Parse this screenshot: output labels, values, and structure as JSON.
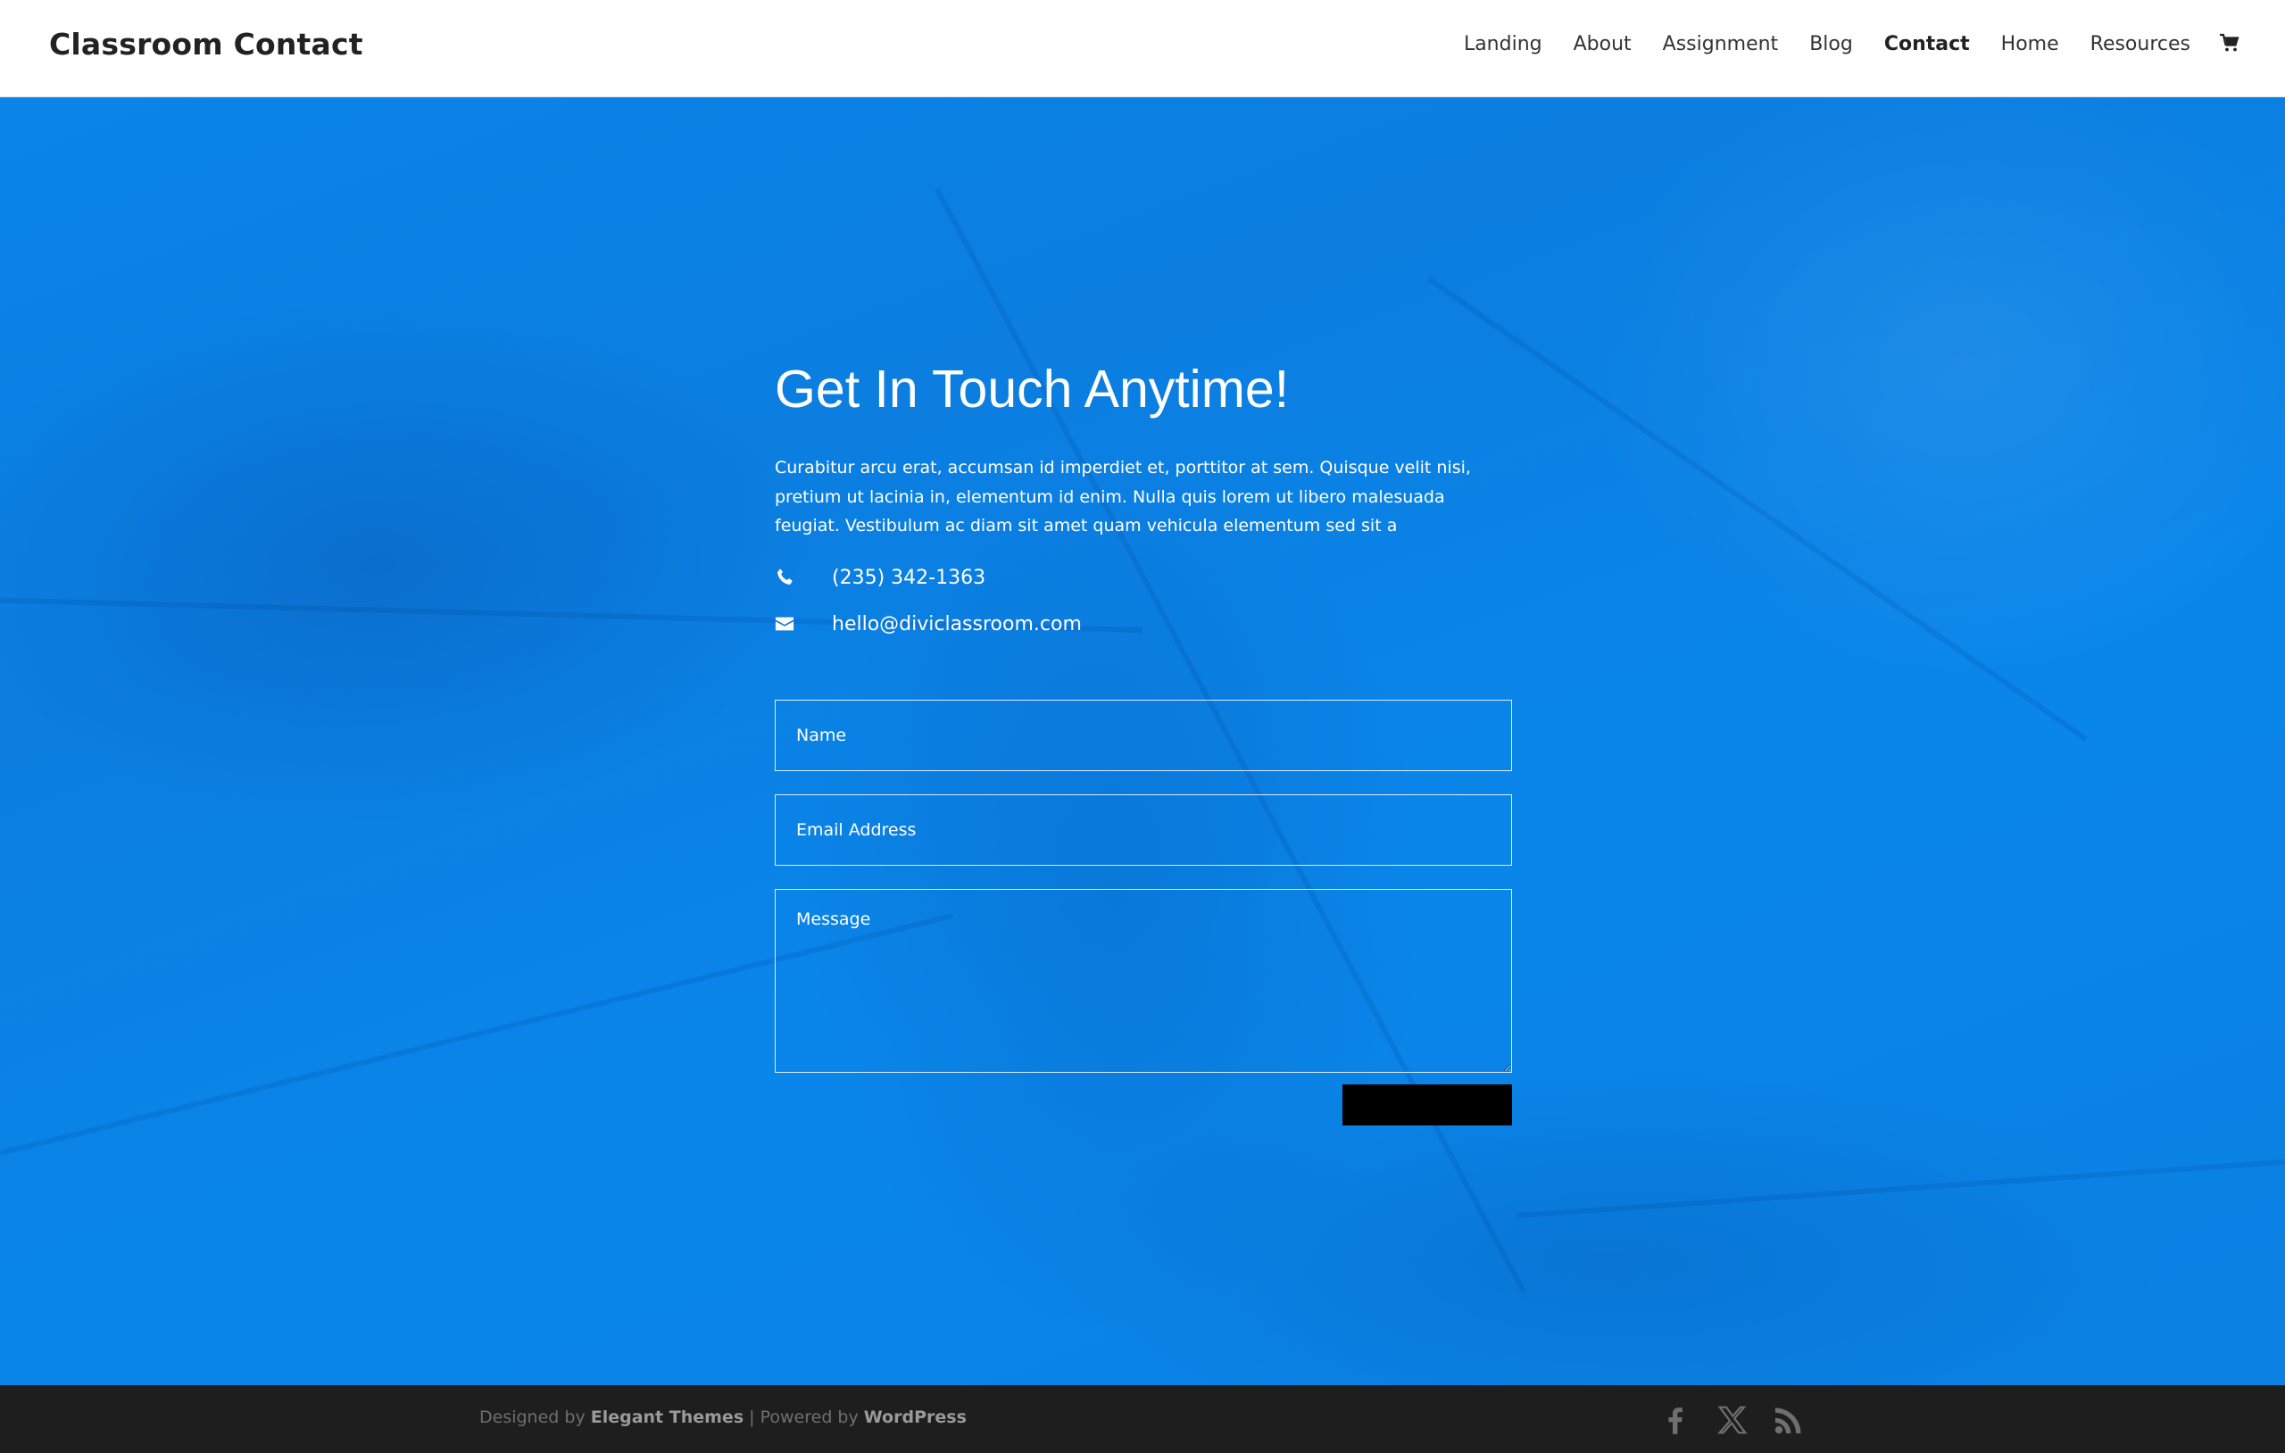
{
  "site": {
    "title": "Classroom Contact"
  },
  "nav": {
    "items": [
      "Landing",
      "About",
      "Assignment",
      "Blog",
      "Contact",
      "Home",
      "Resources"
    ],
    "active": "Contact"
  },
  "hero": {
    "heading": "Get In Touch Anytime!",
    "body": "Curabitur arcu erat, accumsan id imperdiet et, porttitor at sem. Quisque velit nisi, pretium ut lacinia in, elementum id enim. Nulla quis lorem ut libero malesuada feugiat. Vestibulum ac diam sit amet quam vehicula elementum sed sit a",
    "phone": "(235) 342-1363",
    "email": "hello@diviclassroom.com"
  },
  "form": {
    "name_placeholder": "Name",
    "email_placeholder": "Email Address",
    "message_placeholder": "Message",
    "submit_label": ""
  },
  "footer": {
    "designed_by_prefix": "Designed by ",
    "designed_by_name": "Elegant Themes",
    "separator": " | Powered by ",
    "powered_by_name": "WordPress"
  },
  "icons": {
    "cart": "cart-icon",
    "phone": "phone-icon",
    "email": "envelope-icon",
    "social": [
      "facebook-icon",
      "x-icon",
      "rss-icon"
    ]
  },
  "colors": {
    "hero_blue": "#0a84e8",
    "footer_bg": "#1e1e1e",
    "submit_bg": "#000000"
  }
}
